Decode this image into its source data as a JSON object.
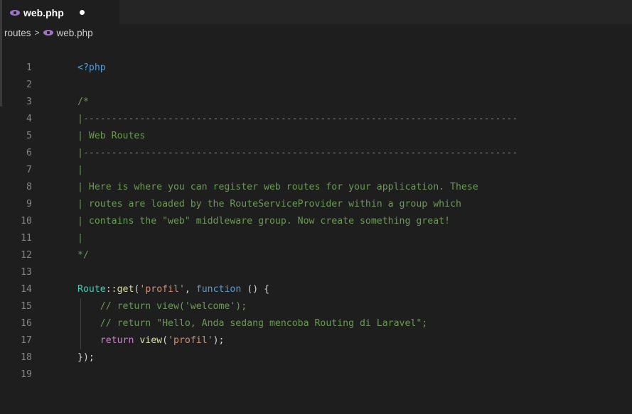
{
  "tab": {
    "title": "web.php",
    "icon": "php-elephant-icon",
    "dirty": true
  },
  "breadcrumb": {
    "folder": "routes",
    "separator": ">",
    "file": "web.php"
  },
  "lines": [
    {
      "n": "1",
      "tokens": [
        {
          "t": "<?php",
          "c": "tag"
        }
      ]
    },
    {
      "n": "2",
      "tokens": []
    },
    {
      "n": "3",
      "tokens": [
        {
          "t": "/*",
          "c": "comment"
        }
      ]
    },
    {
      "n": "4",
      "tokens": [
        {
          "t": "|-----------------------------------------------------------------------------",
          "c": "comment"
        }
      ]
    },
    {
      "n": "5",
      "tokens": [
        {
          "t": "| Web Routes",
          "c": "comment"
        }
      ]
    },
    {
      "n": "6",
      "tokens": [
        {
          "t": "|-----------------------------------------------------------------------------",
          "c": "comment"
        }
      ]
    },
    {
      "n": "7",
      "tokens": [
        {
          "t": "|",
          "c": "comment"
        }
      ]
    },
    {
      "n": "8",
      "tokens": [
        {
          "t": "| Here is where you can register web routes for your application. These",
          "c": "comment"
        }
      ]
    },
    {
      "n": "9",
      "tokens": [
        {
          "t": "| routes are loaded by the RouteServiceProvider within a group which",
          "c": "comment"
        }
      ]
    },
    {
      "n": "10",
      "tokens": [
        {
          "t": "| contains the \"web\" middleware group. Now create something great!",
          "c": "comment"
        }
      ]
    },
    {
      "n": "11",
      "tokens": [
        {
          "t": "|",
          "c": "comment"
        }
      ]
    },
    {
      "n": "12",
      "tokens": [
        {
          "t": "*/",
          "c": "comment"
        }
      ]
    },
    {
      "n": "13",
      "tokens": []
    },
    {
      "n": "14",
      "tokens": [
        {
          "t": "Route",
          "c": "cls"
        },
        {
          "t": "::",
          "c": "punc"
        },
        {
          "t": "get",
          "c": "fn"
        },
        {
          "t": "(",
          "c": "punc"
        },
        {
          "t": "'profil'",
          "c": "str"
        },
        {
          "t": ", ",
          "c": "punc"
        },
        {
          "t": "function",
          "c": "kw"
        },
        {
          "t": " () {",
          "c": "punc"
        }
      ]
    },
    {
      "n": "15",
      "tokens": [
        {
          "t": "    // return view('welcome');",
          "c": "comment"
        }
      ]
    },
    {
      "n": "16",
      "tokens": [
        {
          "t": "    // return \"Hello, Anda sedang mencoba Routing di Laravel\";",
          "c": "comment"
        }
      ]
    },
    {
      "n": "17",
      "tokens": [
        {
          "t": "    ",
          "c": "punc"
        },
        {
          "t": "return",
          "c": "kwc"
        },
        {
          "t": " ",
          "c": "punc"
        },
        {
          "t": "view",
          "c": "fn"
        },
        {
          "t": "(",
          "c": "punc"
        },
        {
          "t": "'profil'",
          "c": "str"
        },
        {
          "t": ");",
          "c": "punc"
        }
      ]
    },
    {
      "n": "18",
      "tokens": [
        {
          "t": "});",
          "c": "punc"
        }
      ]
    },
    {
      "n": "19",
      "tokens": []
    }
  ]
}
